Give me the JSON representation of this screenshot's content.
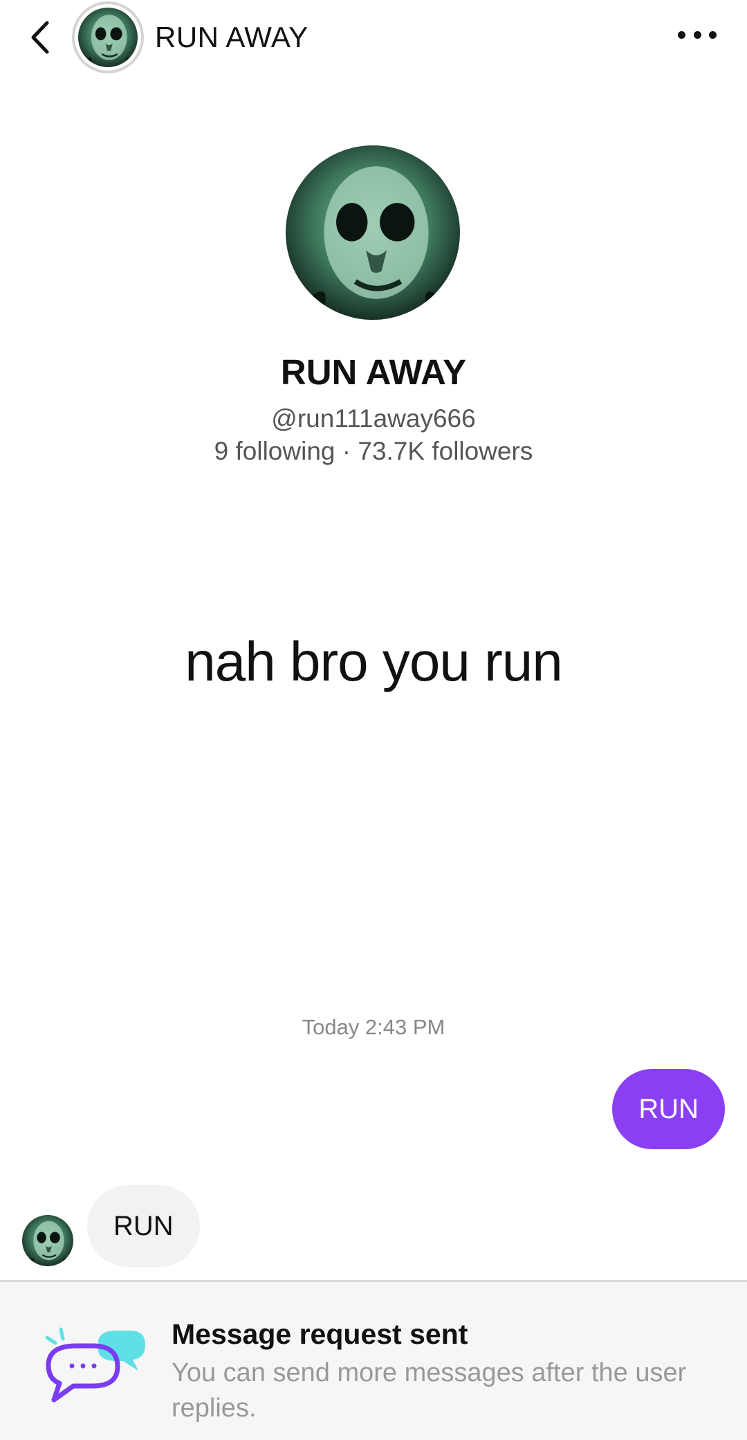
{
  "header": {
    "title": "RUN AWAY"
  },
  "profile": {
    "name": "RUN AWAY",
    "handle": "@run111away666",
    "stats": "9 following · 73.7K followers",
    "bio": "nah bro you run"
  },
  "conversation": {
    "timestamp": "Today 2:43 PM",
    "sent_message": "RUN",
    "received_message": "RUN"
  },
  "request_notice": {
    "title": "Message request sent",
    "subtitle": "You can send more messages after the user replies."
  },
  "colors": {
    "accent": "#8a3ff3",
    "received_bubble": "#f2f2f2",
    "icon_purple": "#7a3cf0",
    "icon_teal": "#5ee0e6"
  },
  "icons": {
    "back": "chevron-left-icon",
    "more": "more-horizontal-icon",
    "request": "chat-bubbles-icon"
  }
}
